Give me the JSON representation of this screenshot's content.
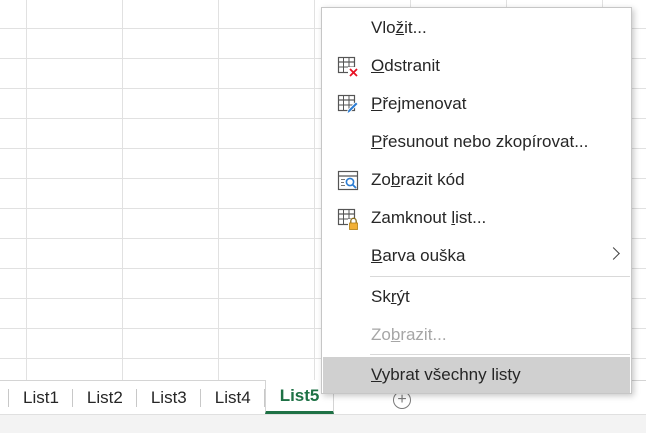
{
  "context_menu": {
    "items": [
      {
        "pre": "Vlo",
        "key": "ž",
        "post": "it...",
        "icon": "",
        "enabled": true
      },
      {
        "pre": "",
        "key": "O",
        "post": "dstranit",
        "icon": "delete-sheet-icon",
        "enabled": true
      },
      {
        "pre": "",
        "key": "P",
        "post": "řejmenovat",
        "icon": "rename-sheet-icon",
        "enabled": true
      },
      {
        "pre": "",
        "key": "P",
        "post": "řesunout nebo zkopírovat...",
        "icon": "",
        "enabled": true
      },
      {
        "pre": "Zo",
        "key": "b",
        "post": "razit kód",
        "icon": "view-code-icon",
        "enabled": true
      },
      {
        "pre": "Zamknout ",
        "key": "l",
        "post": "ist...",
        "icon": "protect-sheet-icon",
        "enabled": true
      },
      {
        "pre": "",
        "key": "B",
        "post": "arva ouška",
        "icon": "",
        "enabled": true,
        "submenu": true
      },
      {
        "pre": "Sk",
        "key": "r",
        "post": "ýt",
        "icon": "",
        "enabled": true
      },
      {
        "pre": "Zo",
        "key": "b",
        "post": "razit...",
        "icon": "",
        "enabled": false
      },
      {
        "pre": "",
        "key": "V",
        "post": "ybrat všechny listy",
        "icon": "",
        "enabled": true,
        "selected": true
      }
    ]
  },
  "sheet_tabs": {
    "tabs": [
      "List1",
      "List2",
      "List3",
      "List4",
      "List5"
    ],
    "active": "List5",
    "add_symbol": "+"
  },
  "colors": {
    "active_tab": "#1e7145",
    "selected_item_bg": "#d0d0d0",
    "delete_x": "#e81123",
    "lock": "#f2b036"
  }
}
